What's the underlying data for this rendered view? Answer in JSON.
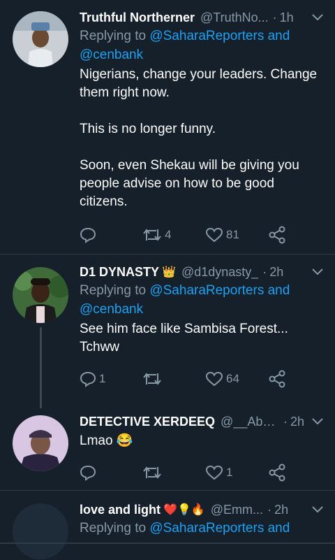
{
  "colors": {
    "background": "#15202b",
    "link": "#1da1f2",
    "muted": "#8899a6",
    "separator": "#2f3a45",
    "heart": "#e0245e"
  },
  "tweets": [
    {
      "name": "Truthful Northerner",
      "handle": "@TruthNo...",
      "dot": "·",
      "time": "1h",
      "replying_prefix": "Replying to ",
      "replying_to": "@SaharaReporters and @cenbank",
      "text": "Nigerians, change your leaders. Change them right now.\n\nThis is no longer funny.\n\nSoon, even Shekau will be giving you people advise on how to be good citizens.",
      "replies": "",
      "retweets": "4",
      "likes": "81"
    },
    {
      "name": "D1 DYNASTY",
      "badge": "👑",
      "handle": "@d1dynasty_",
      "dot": "·",
      "time": "2h",
      "replying_prefix": "Replying to ",
      "replying_to": "@SaharaReporters and @cenbank",
      "text": "See him face like Sambisa Forest... Tchww",
      "replies": "1",
      "retweets": "",
      "likes": "64"
    },
    {
      "name": "DETECTIVE XERDEEQ",
      "handle": "@__Abb...",
      "dot": "·",
      "time": "2h",
      "text": "Lmao 😂",
      "replies": "",
      "retweets": "",
      "likes": "1"
    },
    {
      "name": "love and light",
      "badge": "❤️💡🔥",
      "handle": "@Emm...",
      "dot": "·",
      "time": "2h",
      "replying_prefix": "Replying to ",
      "replying_to": "@SaharaReporters and"
    }
  ]
}
